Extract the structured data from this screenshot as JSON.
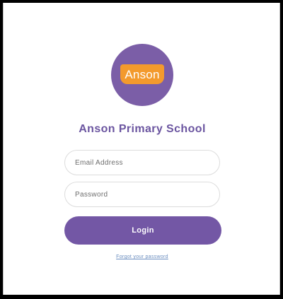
{
  "logo": {
    "text": "Anson",
    "circle_color": "#7b5ea7",
    "badge_color": "#f39a2d"
  },
  "school": {
    "name": "Anson Primary School"
  },
  "form": {
    "email_placeholder": "Email Address",
    "password_placeholder": "Password",
    "login_label": "Login",
    "forgot_label": "Forgot your password"
  },
  "colors": {
    "accent": "#7357a5",
    "link": "#6a8dbf"
  }
}
